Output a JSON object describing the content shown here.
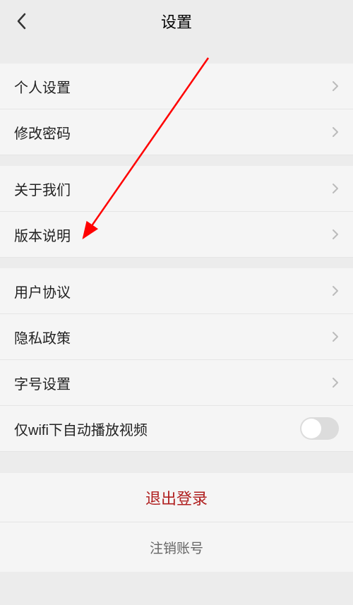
{
  "header": {
    "title": "设置"
  },
  "rows": {
    "personal": "个人设置",
    "password": "修改密码",
    "about": "关于我们",
    "version": "版本说明",
    "agreement": "用户协议",
    "privacy": "隐私政策",
    "fontsize": "字号设置",
    "wifiAutoplay": "仅wifi下自动播放视频"
  },
  "actions": {
    "logout": "退出登录",
    "delete": "注销账号"
  },
  "toggle": {
    "wifiAutoplay": false
  },
  "colors": {
    "logoutText": "#b02020",
    "arrowRed": "#ff0000"
  }
}
